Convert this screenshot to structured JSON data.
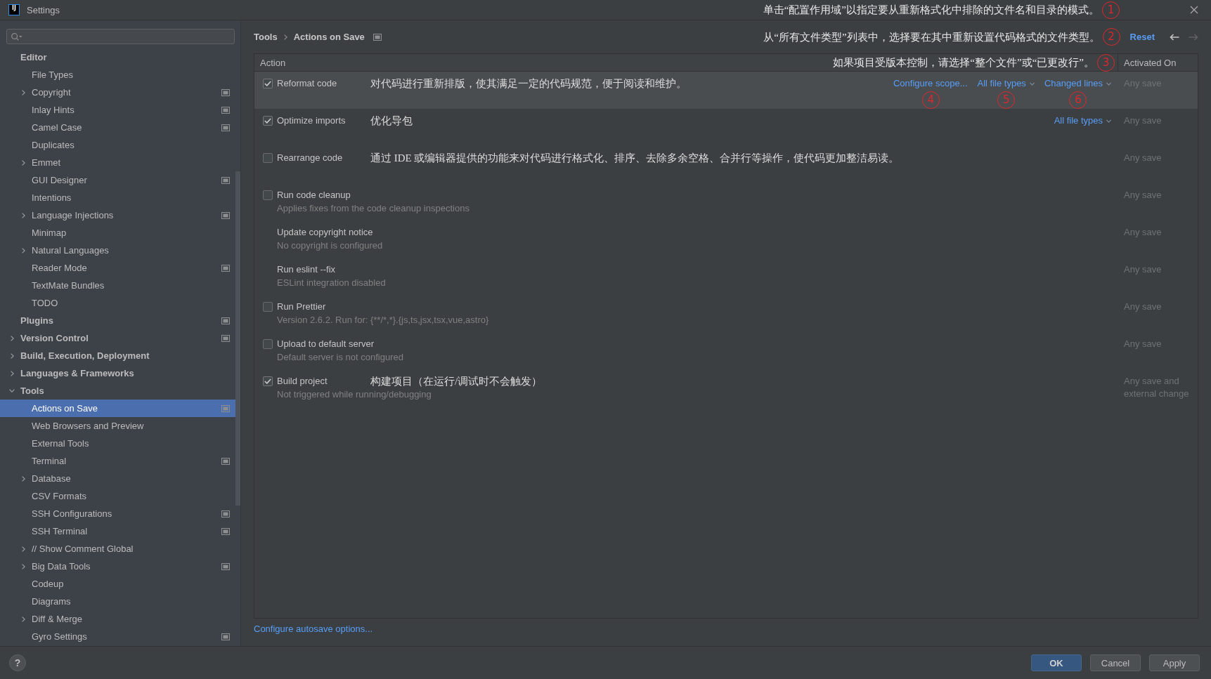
{
  "window": {
    "title": "Settings",
    "logo": "IJ",
    "annotation": {
      "text": "单击“配置作用域”以指定要从重新格式化中排除的文件名和目录的模式。",
      "marker": "1"
    }
  },
  "sidebar": {
    "items": [
      {
        "label": "Editor",
        "selected": false,
        "per_project": false,
        "children": [
          {
            "label": "File Types",
            "selected": false,
            "per_project": false
          },
          {
            "label": "Copyright",
            "selected": false,
            "per_project": true,
            "expanded": false
          },
          {
            "label": "Inlay Hints",
            "selected": false,
            "per_project": true
          },
          {
            "label": "Camel Case",
            "selected": false,
            "per_project": true
          },
          {
            "label": "Duplicates",
            "selected": false,
            "per_project": false
          },
          {
            "label": "Emmet",
            "selected": false,
            "per_project": false,
            "expanded": false
          },
          {
            "label": "GUI Designer",
            "selected": false,
            "per_project": true
          },
          {
            "label": "Intentions",
            "selected": false,
            "per_project": false
          },
          {
            "label": "Language Injections",
            "selected": false,
            "per_project": true,
            "expanded": false
          },
          {
            "label": "Minimap",
            "selected": false,
            "per_project": false
          },
          {
            "label": "Natural Languages",
            "selected": false,
            "per_project": false,
            "expanded": false
          },
          {
            "label": "Reader Mode",
            "selected": false,
            "per_project": true
          },
          {
            "label": "TextMate Bundles",
            "selected": false,
            "per_project": false
          },
          {
            "label": "TODO",
            "selected": false,
            "per_project": false
          }
        ]
      },
      {
        "label": "Plugins",
        "selected": false,
        "per_project": true
      },
      {
        "label": "Version Control",
        "selected": false,
        "per_project": true,
        "expanded": false
      },
      {
        "label": "Build, Execution, Deployment",
        "selected": false,
        "per_project": false,
        "expanded": false
      },
      {
        "label": "Languages & Frameworks",
        "selected": false,
        "per_project": false,
        "expanded": false
      },
      {
        "label": "Tools",
        "selected": false,
        "per_project": false,
        "expanded": true,
        "children": [
          {
            "label": "Actions on Save",
            "selected": true,
            "per_project": true
          },
          {
            "label": "Web Browsers and Preview",
            "selected": false,
            "per_project": false
          },
          {
            "label": "External Tools",
            "selected": false,
            "per_project": false
          },
          {
            "label": "Terminal",
            "selected": false,
            "per_project": true
          },
          {
            "label": "Database",
            "selected": false,
            "per_project": false,
            "expanded": false
          },
          {
            "label": "CSV Formats",
            "selected": false,
            "per_project": false
          },
          {
            "label": "SSH Configurations",
            "selected": false,
            "per_project": true
          },
          {
            "label": "SSH Terminal",
            "selected": false,
            "per_project": true
          },
          {
            "label": "// Show Comment Global",
            "selected": false,
            "per_project": false,
            "expanded": false
          },
          {
            "label": "Big Data Tools",
            "selected": false,
            "per_project": true,
            "expanded": false
          },
          {
            "label": "Codeup",
            "selected": false,
            "per_project": false
          },
          {
            "label": "Diagrams",
            "selected": false,
            "per_project": false
          },
          {
            "label": "Diff & Merge",
            "selected": false,
            "per_project": false,
            "expanded": false
          },
          {
            "label": "Gyro Settings",
            "selected": false,
            "per_project": true
          }
        ]
      }
    ]
  },
  "header": {
    "breadcrumb": [
      "Tools",
      "Actions on Save"
    ],
    "per_project": true,
    "annotation": {
      "text": "从“所有文件类型”列表中，选择要在其中重新设置代码格式的文件类型。",
      "marker": "2"
    },
    "reset": "Reset",
    "nav": [
      {
        "kind": "back",
        "disabled": false
      },
      {
        "kind": "forward",
        "disabled": true
      }
    ]
  },
  "table": {
    "columns": [
      "Action",
      "Activated On"
    ],
    "annotation": {
      "text": "如果项目受版本控制，请选择“整个文件”或“已更改行”。",
      "marker": "3"
    },
    "rows": [
      {
        "kind": "checkbox",
        "label": "Reformat code",
        "checked": true,
        "selected": true,
        "note": "对代码进行重新排版，使其满足一定的代码规范，便于阅读和维护。",
        "options": [
          {
            "kind": "link",
            "text": "Configure scope...",
            "marker": "4"
          },
          {
            "kind": "dropdown",
            "text": "All file types",
            "marker": "5"
          },
          {
            "kind": "dropdown",
            "text": "Changed lines",
            "marker": "6"
          }
        ],
        "activated_on": "Any save"
      },
      {
        "kind": "checkbox",
        "label": "Optimize imports",
        "checked": true,
        "selected": false,
        "note": "优化导包",
        "options": [
          {
            "kind": "dropdown",
            "text": "All file types"
          }
        ],
        "activated_on": "Any save"
      },
      {
        "kind": "checkbox",
        "label": "Rearrange code",
        "checked": false,
        "selected": false,
        "note": "通过 IDE 或编辑器提供的功能来对代码进行格式化、排序、去除多余空格、合并行等操作，使代码更加整洁易读。",
        "activated_on": "Any save"
      },
      {
        "kind": "checkbox",
        "label": "Run code cleanup",
        "checked": false,
        "selected": false,
        "description": "Applies fixes from the code cleanup inspections",
        "activated_on": "Any save"
      },
      {
        "kind": "plain",
        "label": "Update copyright notice",
        "selected": false,
        "description": "No copyright is configured",
        "activated_on": "Any save"
      },
      {
        "kind": "plain",
        "label": "Run eslint --fix",
        "selected": false,
        "description": "ESLint integration disabled",
        "activated_on": "Any save"
      },
      {
        "kind": "checkbox",
        "label": "Run Prettier",
        "checked": false,
        "selected": false,
        "description": "Version 2.6.2. Run for: {**/*,*}.{js,ts,jsx,tsx,vue,astro}",
        "activated_on": "Any save"
      },
      {
        "kind": "checkbox",
        "label": "Upload to default server",
        "checked": false,
        "selected": false,
        "description": "Default server is not configured",
        "activated_on": "Any save"
      },
      {
        "kind": "checkbox",
        "label": "Build project",
        "checked": true,
        "selected": false,
        "note": "构建项目（在运行/调试时不会触发）",
        "description": "Not triggered while running/debugging",
        "activated_on": "Any save and external change"
      }
    ]
  },
  "autosave_link": "Configure autosave options...",
  "footer": {
    "help": "?",
    "buttons": [
      {
        "label": "OK",
        "kind": "primary"
      },
      {
        "label": "Cancel",
        "kind": "default"
      },
      {
        "label": "Apply",
        "kind": "default"
      }
    ]
  }
}
